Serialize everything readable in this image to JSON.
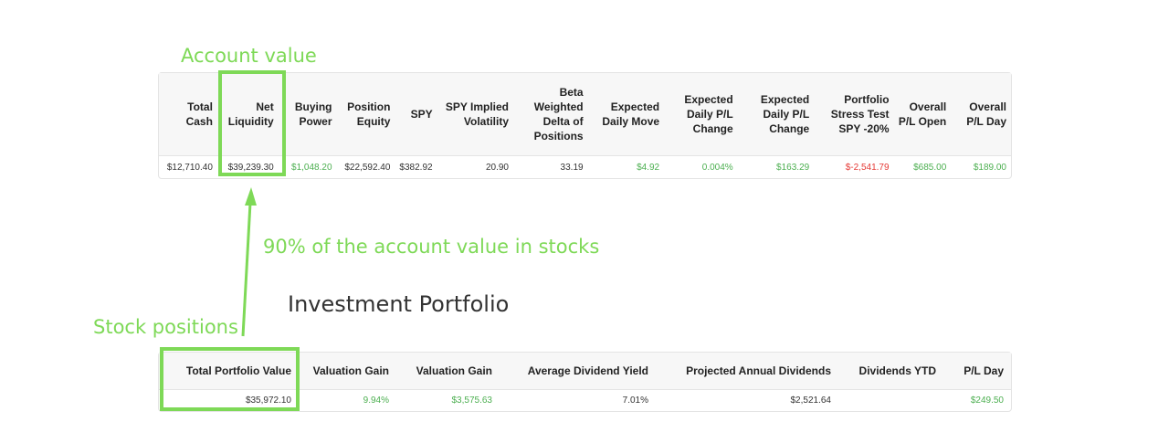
{
  "annotations": {
    "account_value": "Account value",
    "stocks_share": "90% of the account value in stocks",
    "stock_positions": "Stock positions"
  },
  "account_table": {
    "headers": [
      "Total Cash",
      "Net Liquidity",
      "Buying Power",
      "Position Equity",
      "SPY",
      "SPY Implied Volatility",
      "Beta Weighted Delta of Positions",
      "Expected Daily Move",
      "Expected Daily P/L Change",
      "Expected Daily P/L Change",
      "Portfolio Stress Test SPY -20%",
      "Overall P/L Open",
      "Overall P/L Day"
    ],
    "values": [
      "$12,710.40",
      "$39,239.30",
      "$1,048.20",
      "$22,592.40",
      "$382.92",
      "20.90",
      "33.19",
      "$4.92",
      "0.004%",
      "$163.29",
      "$-2,541.79",
      "$685.00",
      "$189.00"
    ]
  },
  "portfolio": {
    "title": "Investment Portfolio",
    "headers": [
      "Total Portfolio Value",
      "Valuation Gain",
      "Valuation Gain",
      "Average Dividend Yield",
      "Projected Annual Dividends",
      "Dividends YTD",
      "P/L Day"
    ],
    "values": [
      "$35,972.10",
      "9.94%",
      "$3,575.63",
      "7.01%",
      "$2,521.64",
      "",
      "$249.50"
    ]
  },
  "colors": {
    "annotation": "#7ed957",
    "positive": "#4caf50",
    "negative": "#e53935"
  }
}
